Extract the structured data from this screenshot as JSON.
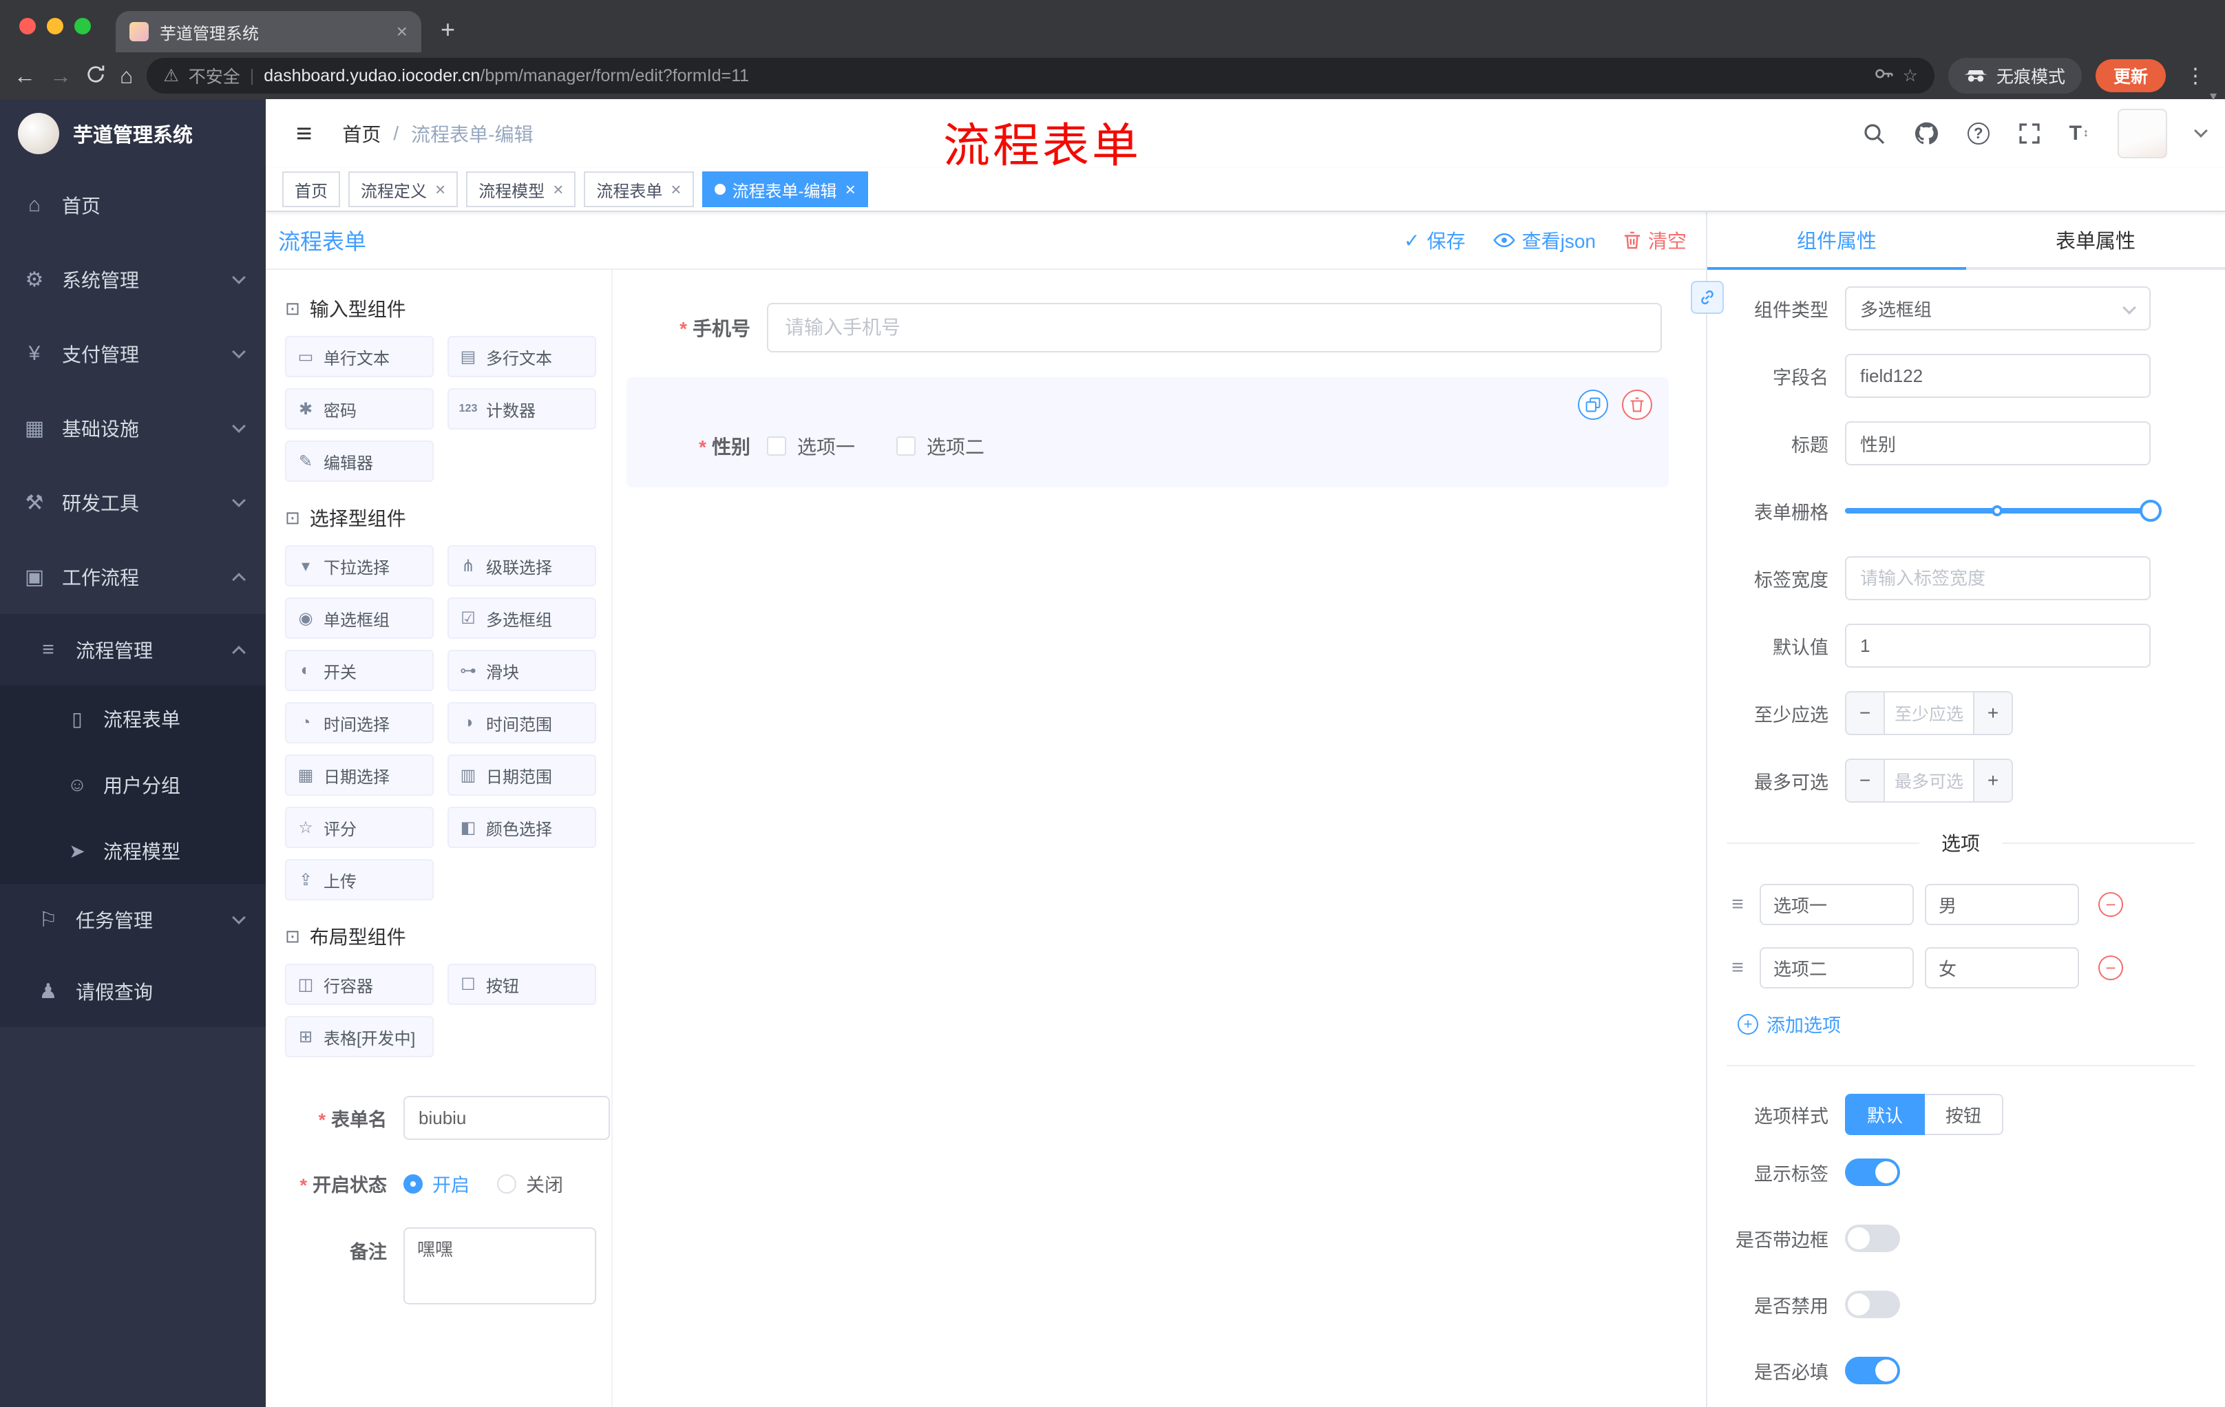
{
  "colors": {
    "accent": "#409eff",
    "danger": "#f56c6c",
    "update_badge": "#e8603c",
    "sidebar_bg": "#2e3446",
    "annotation_red": "#f20a00"
  },
  "browser": {
    "tab_title": "芋道管理系统",
    "address": {
      "security": "不安全",
      "domain": "dashboard.yudao.iocoder.cn",
      "path": "/bpm/manager/form/edit?formId=11"
    },
    "incognito_label": "无痕模式",
    "update_label": "更新"
  },
  "annotation": "流程表单",
  "sidebar": {
    "logo_title": "芋道管理系统",
    "menu": [
      {
        "label": "首页"
      },
      {
        "label": "系统管理"
      },
      {
        "label": "支付管理"
      },
      {
        "label": "基础设施"
      },
      {
        "label": "研发工具"
      },
      {
        "label": "工作流程"
      }
    ],
    "process_group": {
      "label": "流程管理"
    },
    "process_children": [
      {
        "label": "流程表单"
      },
      {
        "label": "用户分组"
      },
      {
        "label": "流程模型"
      }
    ],
    "task_group": {
      "label": "任务管理"
    },
    "leave_item": {
      "label": "请假查询"
    }
  },
  "header": {
    "breadcrumb": [
      "首页",
      "流程表单-编辑"
    ],
    "separator": "/"
  },
  "tags": [
    {
      "label": "首页"
    },
    {
      "label": "流程定义"
    },
    {
      "label": "流程模型"
    },
    {
      "label": "流程表单"
    },
    {
      "label": "流程表单-编辑"
    }
  ],
  "designer": {
    "title": "流程表单",
    "actions": {
      "save": "保存",
      "view_json": "查看json",
      "clear": "清空"
    },
    "palette": {
      "sections": [
        {
          "title": "输入型组件",
          "items": [
            "单行文本",
            "多行文本",
            "密码",
            "计数器",
            "编辑器"
          ]
        },
        {
          "title": "选择型组件",
          "items": [
            "下拉选择",
            "级联选择",
            "单选框组",
            "多选框组",
            "开关",
            "滑块",
            "时间选择",
            "时间范围",
            "日期选择",
            "日期范围",
            "评分",
            "颜色选择",
            "上传"
          ]
        },
        {
          "title": "布局型组件",
          "items": [
            "行容器",
            "按钮",
            "表格[开发中]"
          ]
        }
      ]
    },
    "meta": {
      "name_label": "表单名",
      "name_value": "biubiu",
      "status_label": "开启状态",
      "status_on": "开启",
      "status_off": "关闭",
      "remark_label": "备注",
      "remark_value": "嘿嘿"
    },
    "canvas": {
      "phone": {
        "label": "手机号",
        "placeholder": "请输入手机号"
      },
      "gender": {
        "label": "性别",
        "options": [
          "选项一",
          "选项二"
        ]
      }
    }
  },
  "props": {
    "tabs": [
      "组件属性",
      "表单属性"
    ],
    "type_label": "组件类型",
    "type_value": "多选框组",
    "field_label": "字段名",
    "field_value": "field122",
    "title_label": "标题",
    "title_value": "性别",
    "grid_label": "表单栅格",
    "width_label": "标签宽度",
    "width_placeholder": "请输入标签宽度",
    "default_label": "默认值",
    "default_value": "1",
    "min_label": "至少应选",
    "min_placeholder": "至少应选",
    "max_label": "最多可选",
    "max_placeholder": "最多可选",
    "options_divider": "选项",
    "option_rows": [
      {
        "name": "选项一",
        "value": "男"
      },
      {
        "name": "选项二",
        "value": "女"
      }
    ],
    "add_option": "添加选项",
    "style_label": "选项样式",
    "style_default": "默认",
    "style_button": "按钮",
    "switches": [
      {
        "label": "显示标签",
        "on": true
      },
      {
        "label": "是否带边框",
        "on": false
      },
      {
        "label": "是否禁用",
        "on": false
      },
      {
        "label": "是否必填",
        "on": true
      }
    ]
  }
}
